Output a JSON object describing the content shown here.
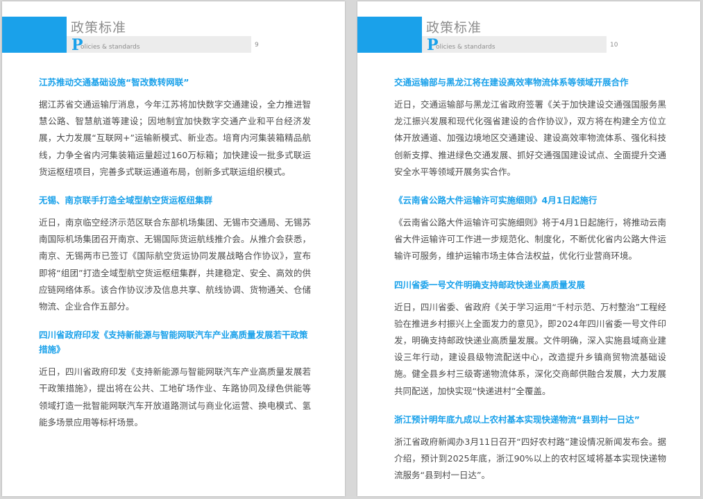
{
  "pages": [
    {
      "header_title": "政策标准",
      "header_sub_initial": "P",
      "header_sub_rest": "olicies & standards",
      "page_number": "9",
      "articles": [
        {
          "title": "江苏推动交通基础设施“智改数转网联”",
          "body": "据江苏省交通运输厅消息，今年江苏将加快数字交通建设，全力推进智慧公路、智慧航道等建设；因地制宜加快数字交通产业和平台经济发展，大力发展“互联网+”运输新模式、新业态。培育内河集装箱精品航线，力争全省内河集装箱运量超过160万标箱；加快建设一批多式联运货运枢纽项目，完善多式联运通道布局，创新多式联运组织模式。"
        },
        {
          "title": "无锡、南京联手打造全域型航空货运枢纽集群",
          "body": "近日，南京临空经济示范区联合东部机场集团、无锡市交通局、无锡苏南国际机场集团召开南京、无锡国际货运航线推介会。从推介会获悉，南京、无锡两市已签订《国际航空货运协同发展战略合作协议》，宣布即将“组团”打造全域型航空货运枢纽集群，共建稳定、安全、高效的供应链网络体系。该合作协议涉及信息共享、航线协调、货物通关、仓储物流、企业合作五部分。"
        },
        {
          "title": "四川省政府印发《支持新能源与智能网联汽车产业高质量发展若干政策措施》",
          "body": "近日，四川省政府印发《支持新能源与智能网联汽车产业高质量发展若干政策措施》，提出将在公共、工地矿场作业、车路协同及绿色供能等领域打造一批智能网联汽车开放道路测试与商业化运营、换电模式、氢能多场景应用等标杆场景。"
        }
      ]
    },
    {
      "header_title": "政策标准",
      "header_sub_initial": "P",
      "header_sub_rest": "olicies & standards",
      "page_number": "10",
      "articles": [
        {
          "title": "交通运输部与黑龙江将在建设高效率物流体系等领域开展合作",
          "body": "近日，交通运输部与黑龙江省政府签署《关于加快建设交通强国服务黑龙江振兴发展和现代化强省建设的合作协议》，双方将在构建全方位立体开放通道、加强边境地区交通建设、建设高效率物流体系、强化科技创新支撑、推进绿色交通发展、抓好交通强国建设试点、全面提升交通安全水平等领域开展务实合作。"
        },
        {
          "title": "《云南省公路大件运输许可实施细则》4月1日起施行",
          "body": "《云南省公路大件运输许可实施细则》将于4月1日起施行，将推动云南省大件运输许可工作进一步规范化、制度化，不断优化省内公路大件运输许可服务，维护运输市场主体合法权益，优化行业营商环境。"
        },
        {
          "title": "四川省委一号文件明确支持邮政快递业高质量发展",
          "body": "近日，四川省委、省政府《关于学习运用“千村示范、万村整治”工程经验在推进乡村振兴上全面发力的意见》，即2024年四川省委一号文件印发，明确支持邮政快递业高质量发展。文件明确，深入实施县域商业建设三年行动，建设县级物流配送中心，改造提升乡镇商贸物流基础设施。健全县乡村三级寄递物流体系，深化交商邮供融合发展，大力发展共同配送，加快实现“快递进村”全覆盖。"
        },
        {
          "title": "浙江预计明年底九成以上农村基本实现快递物流“县到村一日达”",
          "body": "浙江省政府新闻办3月11日召开“四好农村路”建设情况新闻发布会。据介绍，预计到2025年底，浙江90%以上的农村区域将基本实现快递物流服务“县到村一日达”。"
        }
      ]
    }
  ],
  "colors": {
    "accent": "#1aa1ea",
    "header_gray": "#8d8d8d",
    "body_text": "#4a4a4a",
    "header_strip": "#ececec"
  }
}
